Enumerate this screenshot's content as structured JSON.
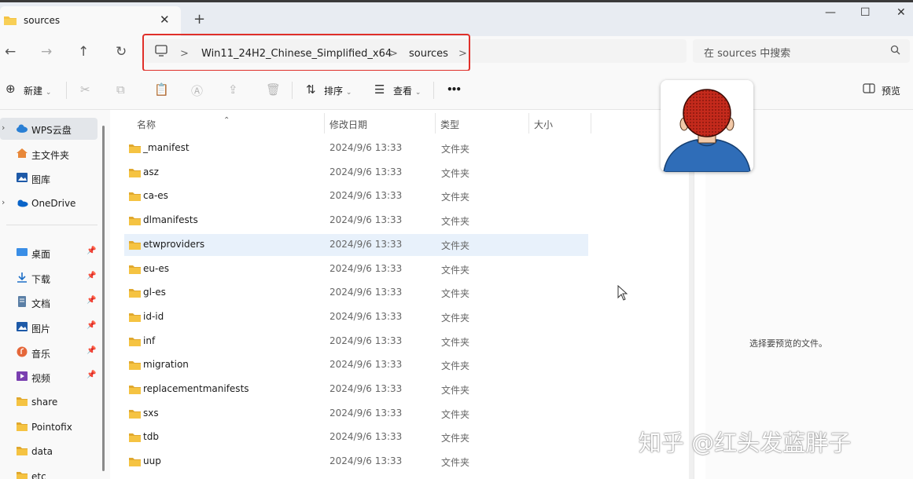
{
  "window": {
    "tab_title": "sources",
    "new_tab": "+",
    "controls": {
      "minimize": "—",
      "maximize": "☐",
      "close": "✕"
    }
  },
  "address_bar": {
    "back": "←",
    "forward": "→",
    "up": "↑",
    "refresh": "↻",
    "breadcrumbs": [
      "Win11_24H2_Chinese_Simplified_x64",
      "sources"
    ],
    "separator": ">",
    "search_placeholder": "在 sources 中搜索"
  },
  "toolbar": {
    "new_label": "新建",
    "sort_label": "排序",
    "view_label": "查看",
    "more_label": "•••",
    "preview_label": "预览"
  },
  "sidebar": {
    "items": [
      {
        "label": "WPS云盘",
        "icon": "cloud-icon",
        "expandable": true,
        "selected": true
      },
      {
        "label": "主文件夹",
        "icon": "home-icon"
      },
      {
        "label": "图库",
        "icon": "gallery-icon"
      },
      {
        "label": "OneDrive",
        "icon": "onedrive-icon",
        "expandable": true
      },
      {
        "label": "桌面",
        "icon": "desktop-icon",
        "pinned": true
      },
      {
        "label": "下载",
        "icon": "download-icon",
        "pinned": true
      },
      {
        "label": "文档",
        "icon": "document-icon",
        "pinned": true
      },
      {
        "label": "图片",
        "icon": "pictures-icon",
        "pinned": true
      },
      {
        "label": "音乐",
        "icon": "music-icon",
        "pinned": true
      },
      {
        "label": "视频",
        "icon": "video-icon",
        "pinned": true
      },
      {
        "label": "share",
        "icon": "folder-icon"
      },
      {
        "label": "Pointofix",
        "icon": "folder-icon"
      },
      {
        "label": "data",
        "icon": "folder-icon"
      },
      {
        "label": "etc",
        "icon": "folder-icon"
      }
    ]
  },
  "columns": {
    "name": "名称",
    "date": "修改日期",
    "type": "类型",
    "size": "大小"
  },
  "files": [
    {
      "name": "_manifest",
      "date": "2024/9/6 13:33",
      "type": "文件夹"
    },
    {
      "name": "asz",
      "date": "2024/9/6 13:33",
      "type": "文件夹"
    },
    {
      "name": "ca-es",
      "date": "2024/9/6 13:33",
      "type": "文件夹"
    },
    {
      "name": "dlmanifests",
      "date": "2024/9/6 13:33",
      "type": "文件夹"
    },
    {
      "name": "etwproviders",
      "date": "2024/9/6 13:33",
      "type": "文件夹",
      "hovered": true
    },
    {
      "name": "eu-es",
      "date": "2024/9/6 13:33",
      "type": "文件夹"
    },
    {
      "name": "gl-es",
      "date": "2024/9/6 13:33",
      "type": "文件夹"
    },
    {
      "name": "id-id",
      "date": "2024/9/6 13:33",
      "type": "文件夹"
    },
    {
      "name": "inf",
      "date": "2024/9/6 13:33",
      "type": "文件夹"
    },
    {
      "name": "migration",
      "date": "2024/9/6 13:33",
      "type": "文件夹"
    },
    {
      "name": "replacementmanifests",
      "date": "2024/9/6 13:33",
      "type": "文件夹"
    },
    {
      "name": "sxs",
      "date": "2024/9/6 13:33",
      "type": "文件夹"
    },
    {
      "name": "tdb",
      "date": "2024/9/6 13:33",
      "type": "文件夹"
    },
    {
      "name": "uup",
      "date": "2024/9/6 13:33",
      "type": "文件夹"
    }
  ],
  "preview_pane": {
    "message": "选择要预览的文件。"
  },
  "watermark": "知乎 @红头发蓝胖子",
  "colors": {
    "folder": "#f5c342",
    "folder_dark": "#e0a82e",
    "highlight_box": "#e0302a",
    "hover_row": "#e8f1fb",
    "accent": "#0067c0"
  }
}
